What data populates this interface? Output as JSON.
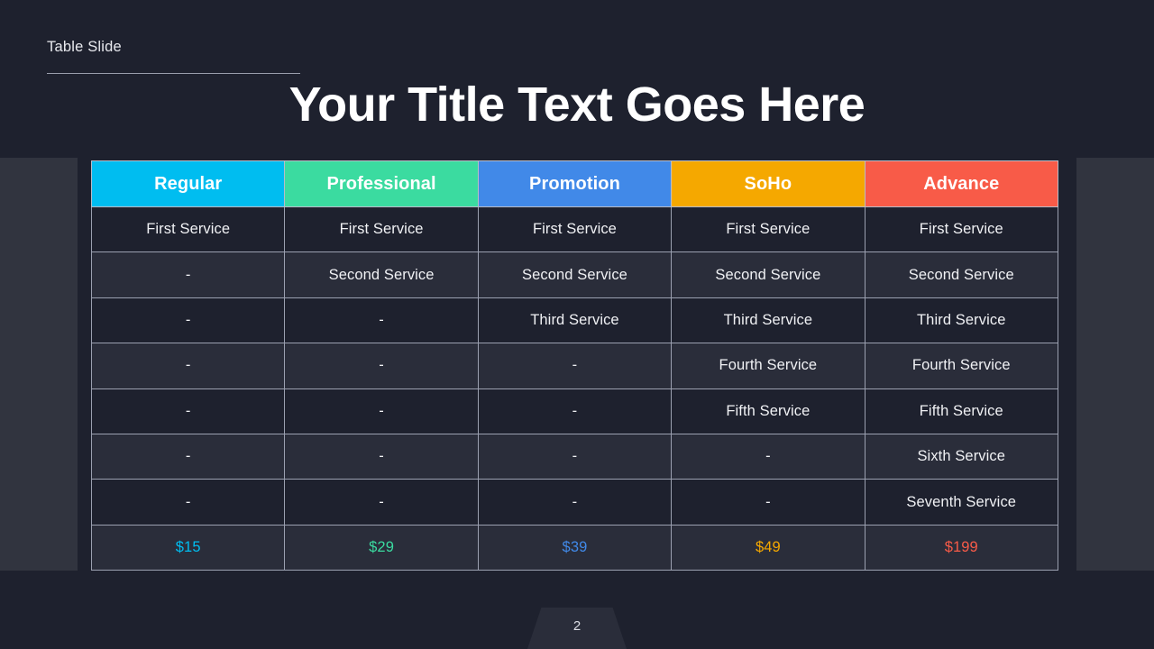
{
  "slide": {
    "eyebrow": "Table Slide",
    "title": "Your Title Text Goes Here",
    "page_number": "2",
    "background_color": "#1e212e",
    "side_band_color": "#31343f"
  },
  "table": {
    "columns": [
      {
        "label": "Regular",
        "color": "#00bdf0"
      },
      {
        "label": "Professional",
        "color": "#3bdba0"
      },
      {
        "label": "Promotion",
        "color": "#4189e8"
      },
      {
        "label": "SoHo",
        "color": "#f5a800"
      },
      {
        "label": "Advance",
        "color": "#f85b48"
      }
    ],
    "rows": [
      {
        "cells": [
          "First Service",
          "First Service",
          "First Service",
          "First Service",
          "First Service"
        ]
      },
      {
        "cells": [
          "-",
          "Second Service",
          "Second Service",
          "Second Service",
          "Second Service"
        ]
      },
      {
        "cells": [
          "-",
          "-",
          "Third Service",
          "Third Service",
          "Third Service"
        ]
      },
      {
        "cells": [
          "-",
          "-",
          "-",
          "Fourth Service",
          "Fourth Service"
        ]
      },
      {
        "cells": [
          "-",
          "-",
          "-",
          "Fifth Service",
          "Fifth Service"
        ]
      },
      {
        "cells": [
          "-",
          "-",
          "-",
          "-",
          "Sixth Service"
        ]
      },
      {
        "cells": [
          "-",
          "-",
          "-",
          "-",
          "Seventh Service"
        ]
      }
    ],
    "prices": [
      "$15",
      "$29",
      "$39",
      "$49",
      "$199"
    ]
  }
}
